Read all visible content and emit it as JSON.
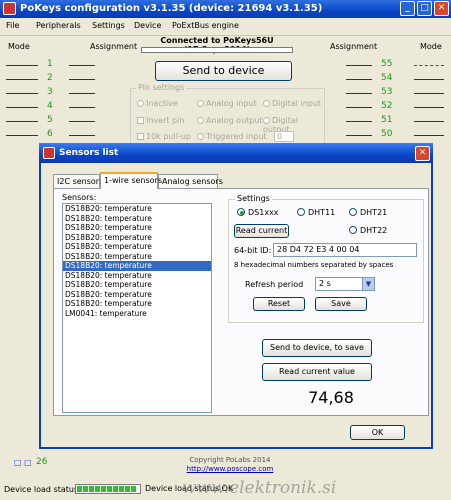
{
  "window": {
    "title": "PoKeys configuration v3.1.35 (device: 21694 v3.1.35)",
    "minimize": "_",
    "maximize": "□",
    "close": "✕"
  },
  "menu": [
    "File",
    "Peripherals",
    "Settings",
    "Device",
    "PoExtBus engine"
  ],
  "header": {
    "connection": "Connected to PoKeys56U (17.Sep. 2014)",
    "mode_left": "Mode",
    "assignment_left": "Assignment",
    "assignment_right": "Assignment",
    "mode_right": "Mode",
    "send_button": "Send to device"
  },
  "pins_left": [
    "1",
    "2",
    "3",
    "4",
    "5",
    "6"
  ],
  "pins_right": [
    "55",
    "54",
    "53",
    "52",
    "51",
    "50"
  ],
  "pin_settings": {
    "caption": "Pin settings",
    "inactive": "Inactive",
    "analog_input": "Analog input",
    "digital_input": "Digital input",
    "invert_pin": "Invert pin",
    "analog_output": "Analog output",
    "digital_output": "Digital output",
    "pullup": "10k pull-up",
    "triggered_input": "Triggered input",
    "triggered_value": "0"
  },
  "dialog": {
    "title": "Sensors list",
    "close": "✕",
    "tabs": [
      "I2C sensors",
      "1-wire sensors",
      "Analog sensors"
    ],
    "sensors_label": "Sensors:",
    "sensors": [
      "DS18B20: temperature",
      "DS18B20: temperature",
      "DS18B20: temperature",
      "DS18B20: temperature",
      "DS18B20: temperature",
      "DS18B20: temperature",
      "DS18B20: temperature",
      "DS18B20: temperature",
      "DS18B20: temperature",
      "DS18B20: temperature",
      "DS18B20: temperature",
      "LM0041: temperature"
    ],
    "selected_index": 6,
    "settings": {
      "caption": "Settings",
      "radio_ds1xxx": "DS1xxx",
      "radio_dht11": "DHT11",
      "radio_dht21": "DHT21",
      "radio_dht22": "DHT22",
      "read_current": "Read current",
      "id_label": "64-bit ID:",
      "id_value": "28 D4 72 E3 4 00 04",
      "hint": "8 hexadecimal numbers separated by spaces",
      "refresh_label": "Refresh period",
      "refresh_value": "2 s",
      "reset": "Reset",
      "save": "Save"
    },
    "send_to_device": "Send to device, to save",
    "read_value": "Read current value",
    "value": "74,68",
    "ok": "OK"
  },
  "footer": {
    "copyright": "Copyright PoLabs 2014",
    "link": "http://www.poscope.com",
    "device_load": "Device load status:",
    "status_msg": "Device load status OK",
    "bottom_pin": "26",
    "bottom_icon": "□ □",
    "load_fraction": 0.95
  },
  "watermark": "www.elektronik.si",
  "colors": {
    "titlebar": "#0a46c8",
    "pin_number": "#1a9a1a",
    "selection": "#316ac5",
    "tab_accent": "#f3a52f"
  }
}
